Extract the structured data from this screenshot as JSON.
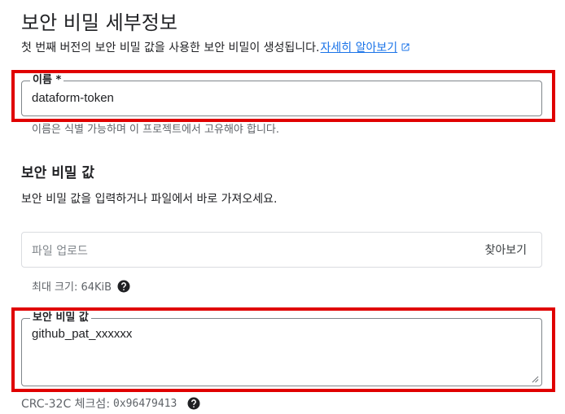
{
  "header": {
    "title": "보안 비밀 세부정보",
    "intro_text": "첫 번째 버전의 보안 비밀 값을 사용한 보안 비밀이 생성됩니다.",
    "learn_more_link": "자세히 알아보기"
  },
  "name_field": {
    "label": "이름 *",
    "value": "dataform-token",
    "hint": "이름은 식별 가능하며 이 프로젝트에서 고유해야 합니다."
  },
  "secret_value_section": {
    "title": "보안 비밀 값",
    "description": "보안 비밀 값을 입력하거나 파일에서 바로 가져오세요.",
    "upload_placeholder": "파일 업로드",
    "browse_button": "찾아보기",
    "max_size_note": "최대 크기: 64KiB"
  },
  "secret_value_field": {
    "label": "보안 비밀 값",
    "value": "github_pat_xxxxxx"
  },
  "checksum": {
    "label": "CRC-32C 체크섬:",
    "value": "0x96479413"
  },
  "icons": {
    "external_link": "open-in-new-icon",
    "help": "help-icon",
    "resize": "resize-handle-icon"
  },
  "colors": {
    "link": "#1a73e8",
    "highlight": "#e00000",
    "muted_text": "#5f6368"
  }
}
